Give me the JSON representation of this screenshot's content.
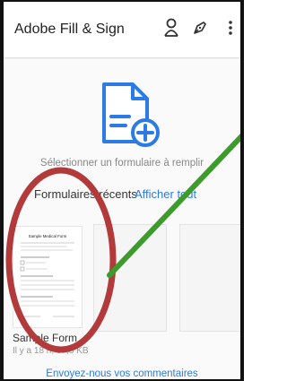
{
  "app_bar": {
    "title": "Adobe Fill & Sign"
  },
  "icons": {
    "account": "person-icon",
    "sign": "pen-nib-icon",
    "menu": "more-vert-icon",
    "new_form": "document-add-icon"
  },
  "main": {
    "select_form_text": "Sélectionner un formulaire à remplir",
    "recent_forms_title": "Formulaires récents",
    "show_all_link": "Afficher tout",
    "feedback_link": "Envoyez-nous vos commentaires"
  },
  "recent_forms": [
    {
      "name": "Sample Form",
      "meta": "Il y a 18 h, 87,8 KB"
    }
  ],
  "doc_preview": {
    "heading": "Sample Medical Form"
  },
  "colors": {
    "accent": "#2c7be5",
    "annotation_red": "#b23a3a",
    "annotation_green": "#3c9b2b"
  }
}
